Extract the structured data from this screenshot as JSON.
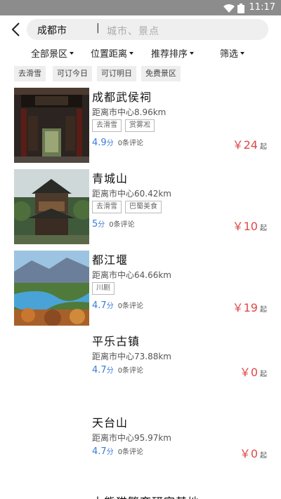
{
  "status_bar": {
    "time": "11:17"
  },
  "search": {
    "city": "成都市",
    "separator": "|",
    "placeholder": "城市、景点"
  },
  "filters": [
    {
      "label": "全部景区"
    },
    {
      "label": "位置距离"
    },
    {
      "label": "推荐排序"
    },
    {
      "label": "筛选"
    }
  ],
  "quick_tags": [
    "去滑雪",
    "可订今日",
    "可订明日",
    "免费景区"
  ],
  "spots": [
    {
      "name": "成都武侯祠",
      "distance": "距离市中心8.96km",
      "tags": [
        "去滑雪",
        "赏雾凇"
      ],
      "score": "4.9",
      "score_unit": "分",
      "reviews": "0条评论",
      "price": "￥24",
      "price_suffix": "起"
    },
    {
      "name": "青城山",
      "distance": "距离市中心60.42km",
      "tags": [
        "去滑雪",
        "巴蜀美食"
      ],
      "score": "5",
      "score_unit": "分",
      "reviews": "0条评论",
      "price": "￥10",
      "price_suffix": "起"
    },
    {
      "name": "都江堰",
      "distance": "距离市中心64.66km",
      "tags": [
        "川剧"
      ],
      "score": "4.7",
      "score_unit": "分",
      "reviews": "0条评论",
      "price": "￥19",
      "price_suffix": "起"
    },
    {
      "name": "平乐古镇",
      "distance": "距离市中心73.88km",
      "tags": [],
      "score": "4.7",
      "score_unit": "分",
      "reviews": "0条评论",
      "price": "￥0",
      "price_suffix": "起"
    },
    {
      "name": "天台山",
      "distance": "距离市中心95.97km",
      "tags": [],
      "score": "4.7",
      "score_unit": "分",
      "reviews": "0条评论",
      "price": "￥0",
      "price_suffix": "起"
    }
  ],
  "partial_next_title": "大熊猫繁育研究基地",
  "colors": {
    "accent_blue": "#3a7ad9",
    "price_red": "#e04848",
    "statusbar": "#8c8c8c"
  },
  "icons": {
    "back": "chevron-left-icon",
    "wifi": "wifi-icon",
    "battery": "battery-icon"
  }
}
